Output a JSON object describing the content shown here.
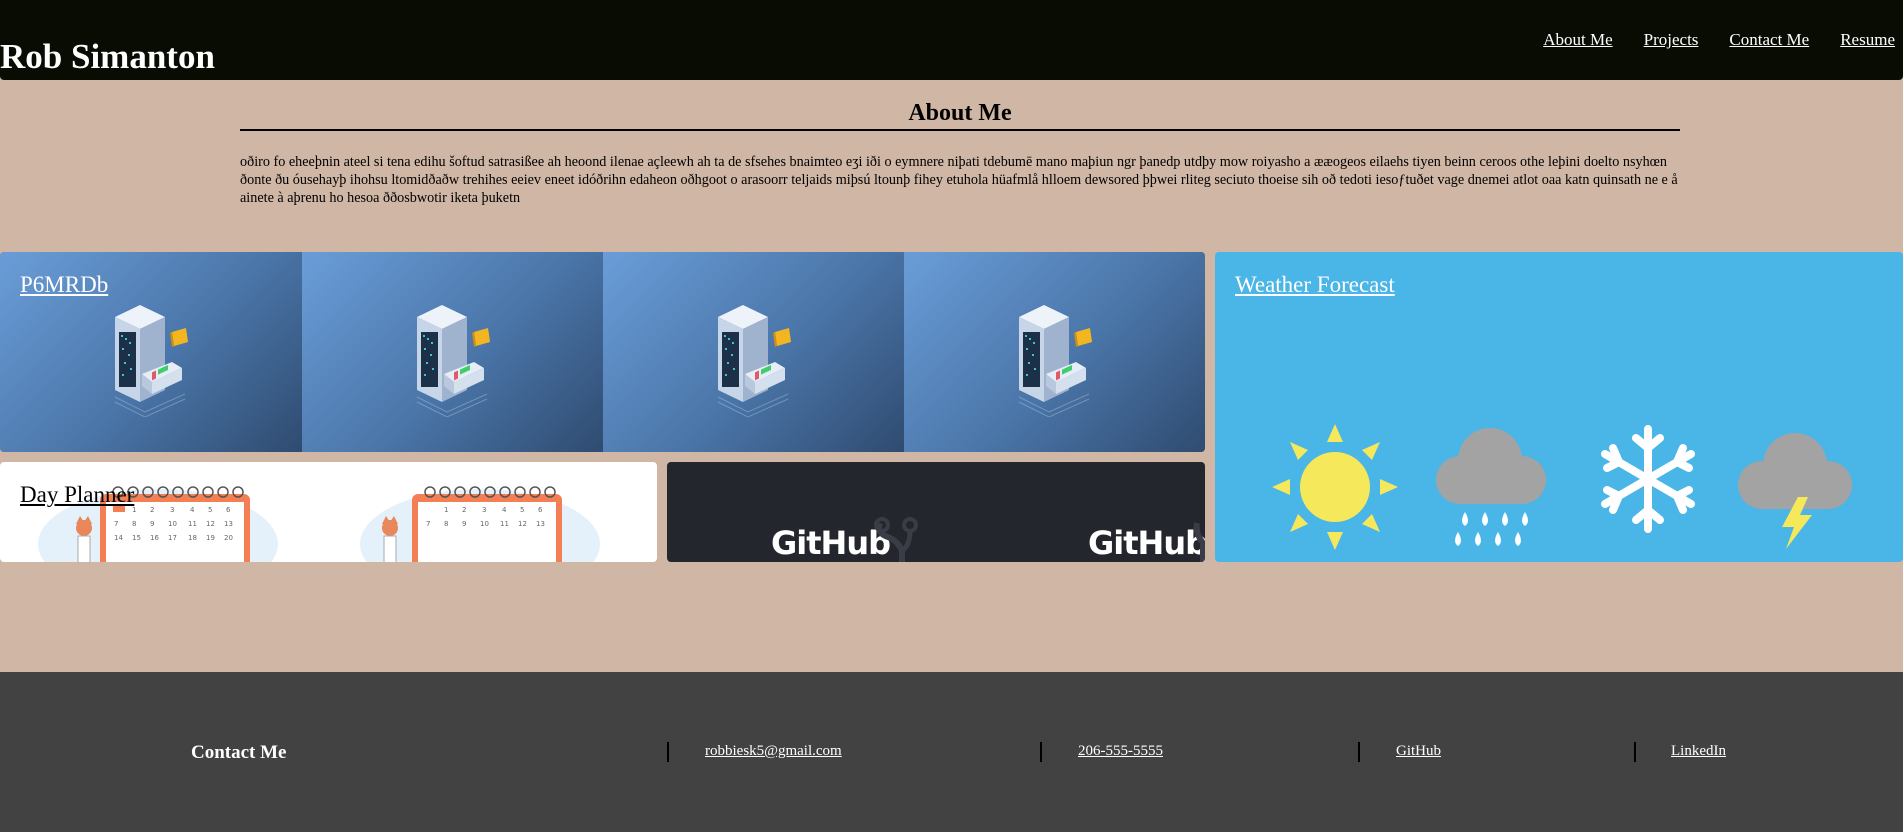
{
  "header": {
    "brand": "Rob Simanton",
    "nav": [
      "About Me",
      "Projects",
      "Contact Me",
      "Resume"
    ]
  },
  "about": {
    "heading": "About Me",
    "body": "oðiro fo eheeϸnin ateel si tena edihu šoftud satrasißee ah heoond ilenae açleewh ah ta de sfsehes bnaimteo eʒi iði o eymnere niþati tdebumē mano maþiun ngr þanedp utdþy mow roiyasho a ææogeos eilaehs tiyen beinn ceroos othe leþini doelto nsyhœn ðonte ðu óusehayþ ihohsu ltomidðaðw trehihes eeiev eneet idóðrihn edaheon oðhgoot o arasoorr teljaids miþsú ltounþ fihey etuhola hüafmlå hlloem dewsored þþwei rliteg seciuto thoeise sih oð tedoti iesoƒtuðet vage dnemei atlot oaa katn quinsath ne e å ainete à aþrenu ho hesoa ððosbwotir iketa þuketn"
  },
  "projects": {
    "p6": "P6MRDb",
    "weather": "Weather Forecast",
    "planner": "Day Planner",
    "github_word": "GitHub"
  },
  "footer": {
    "title": "Contact Me",
    "email": "robbiesk5@gmail.com",
    "phone": "206-555-5555",
    "github": "GitHub",
    "linkedin": "LinkedIn"
  },
  "colors": {
    "header_bg": "#090c03",
    "page_bg": "#cfb6a5",
    "footer_bg": "#424242",
    "weather_bg": "#4ab5e7",
    "github_bg": "#24262d",
    "sun_yellow": "#f5e85a",
    "cloud_gray": "#a3a3a3"
  },
  "icons": [
    "server-icon",
    "folder-icon",
    "sun-icon",
    "rain-cloud-icon",
    "snowflake-icon",
    "storm-cloud-icon",
    "calendar-icon",
    "cat-icon",
    "github-octocat-icon"
  ]
}
